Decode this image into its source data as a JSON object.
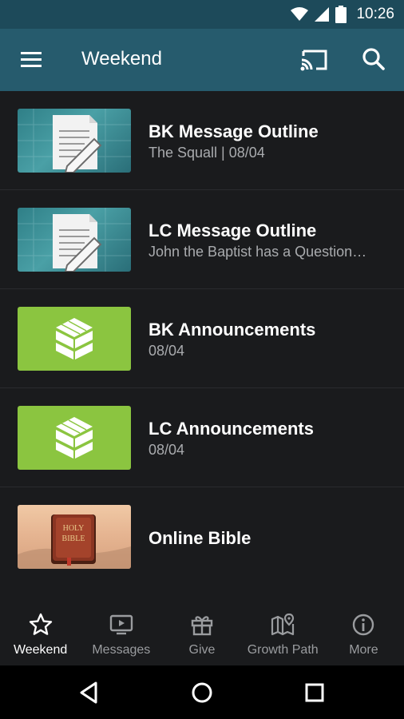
{
  "status_bar": {
    "time": "10:26",
    "icons": [
      "wifi-icon",
      "cell-signal-icon",
      "battery-icon"
    ]
  },
  "toolbar": {
    "menu_icon": "hamburger-menu-icon",
    "title": "Weekend",
    "cast_icon": "cast-icon",
    "search_icon": "search-icon"
  },
  "list": {
    "items": [
      {
        "title": "BK Message Outline",
        "subtitle": "The Squall | 08/04",
        "thumb_icon": "document-pencil-icon"
      },
      {
        "title": "LC Message Outline",
        "subtitle": "John the Baptist has a Question…",
        "thumb_icon": "document-pencil-icon"
      },
      {
        "title": "BK Announcements",
        "subtitle": "08/04",
        "thumb_icon": "church-logo-icon"
      },
      {
        "title": "LC Announcements",
        "subtitle": "08/04",
        "thumb_icon": "church-logo-icon"
      },
      {
        "title": "Online Bible",
        "subtitle": "",
        "thumb_icon": "holy-bible-icon",
        "thumb_text": "HOLY BIBLE"
      }
    ]
  },
  "bottom_nav": {
    "items": [
      {
        "label": "Weekend",
        "icon": "star-icon",
        "active": true
      },
      {
        "label": "Messages",
        "icon": "video-icon",
        "active": false
      },
      {
        "label": "Give",
        "icon": "gift-icon",
        "active": false
      },
      {
        "label": "Growth Path",
        "icon": "map-pin-icon",
        "active": false
      },
      {
        "label": "More",
        "icon": "info-icon",
        "active": false
      }
    ]
  },
  "system_nav": {
    "icons": [
      "back-icon",
      "home-icon",
      "recents-icon"
    ]
  },
  "colors": {
    "status_bar": "#1d4a5a",
    "toolbar": "#265b6d",
    "background": "#1a1b1d",
    "green_accent": "#8bc540",
    "subtitle_text": "#a9abae"
  }
}
